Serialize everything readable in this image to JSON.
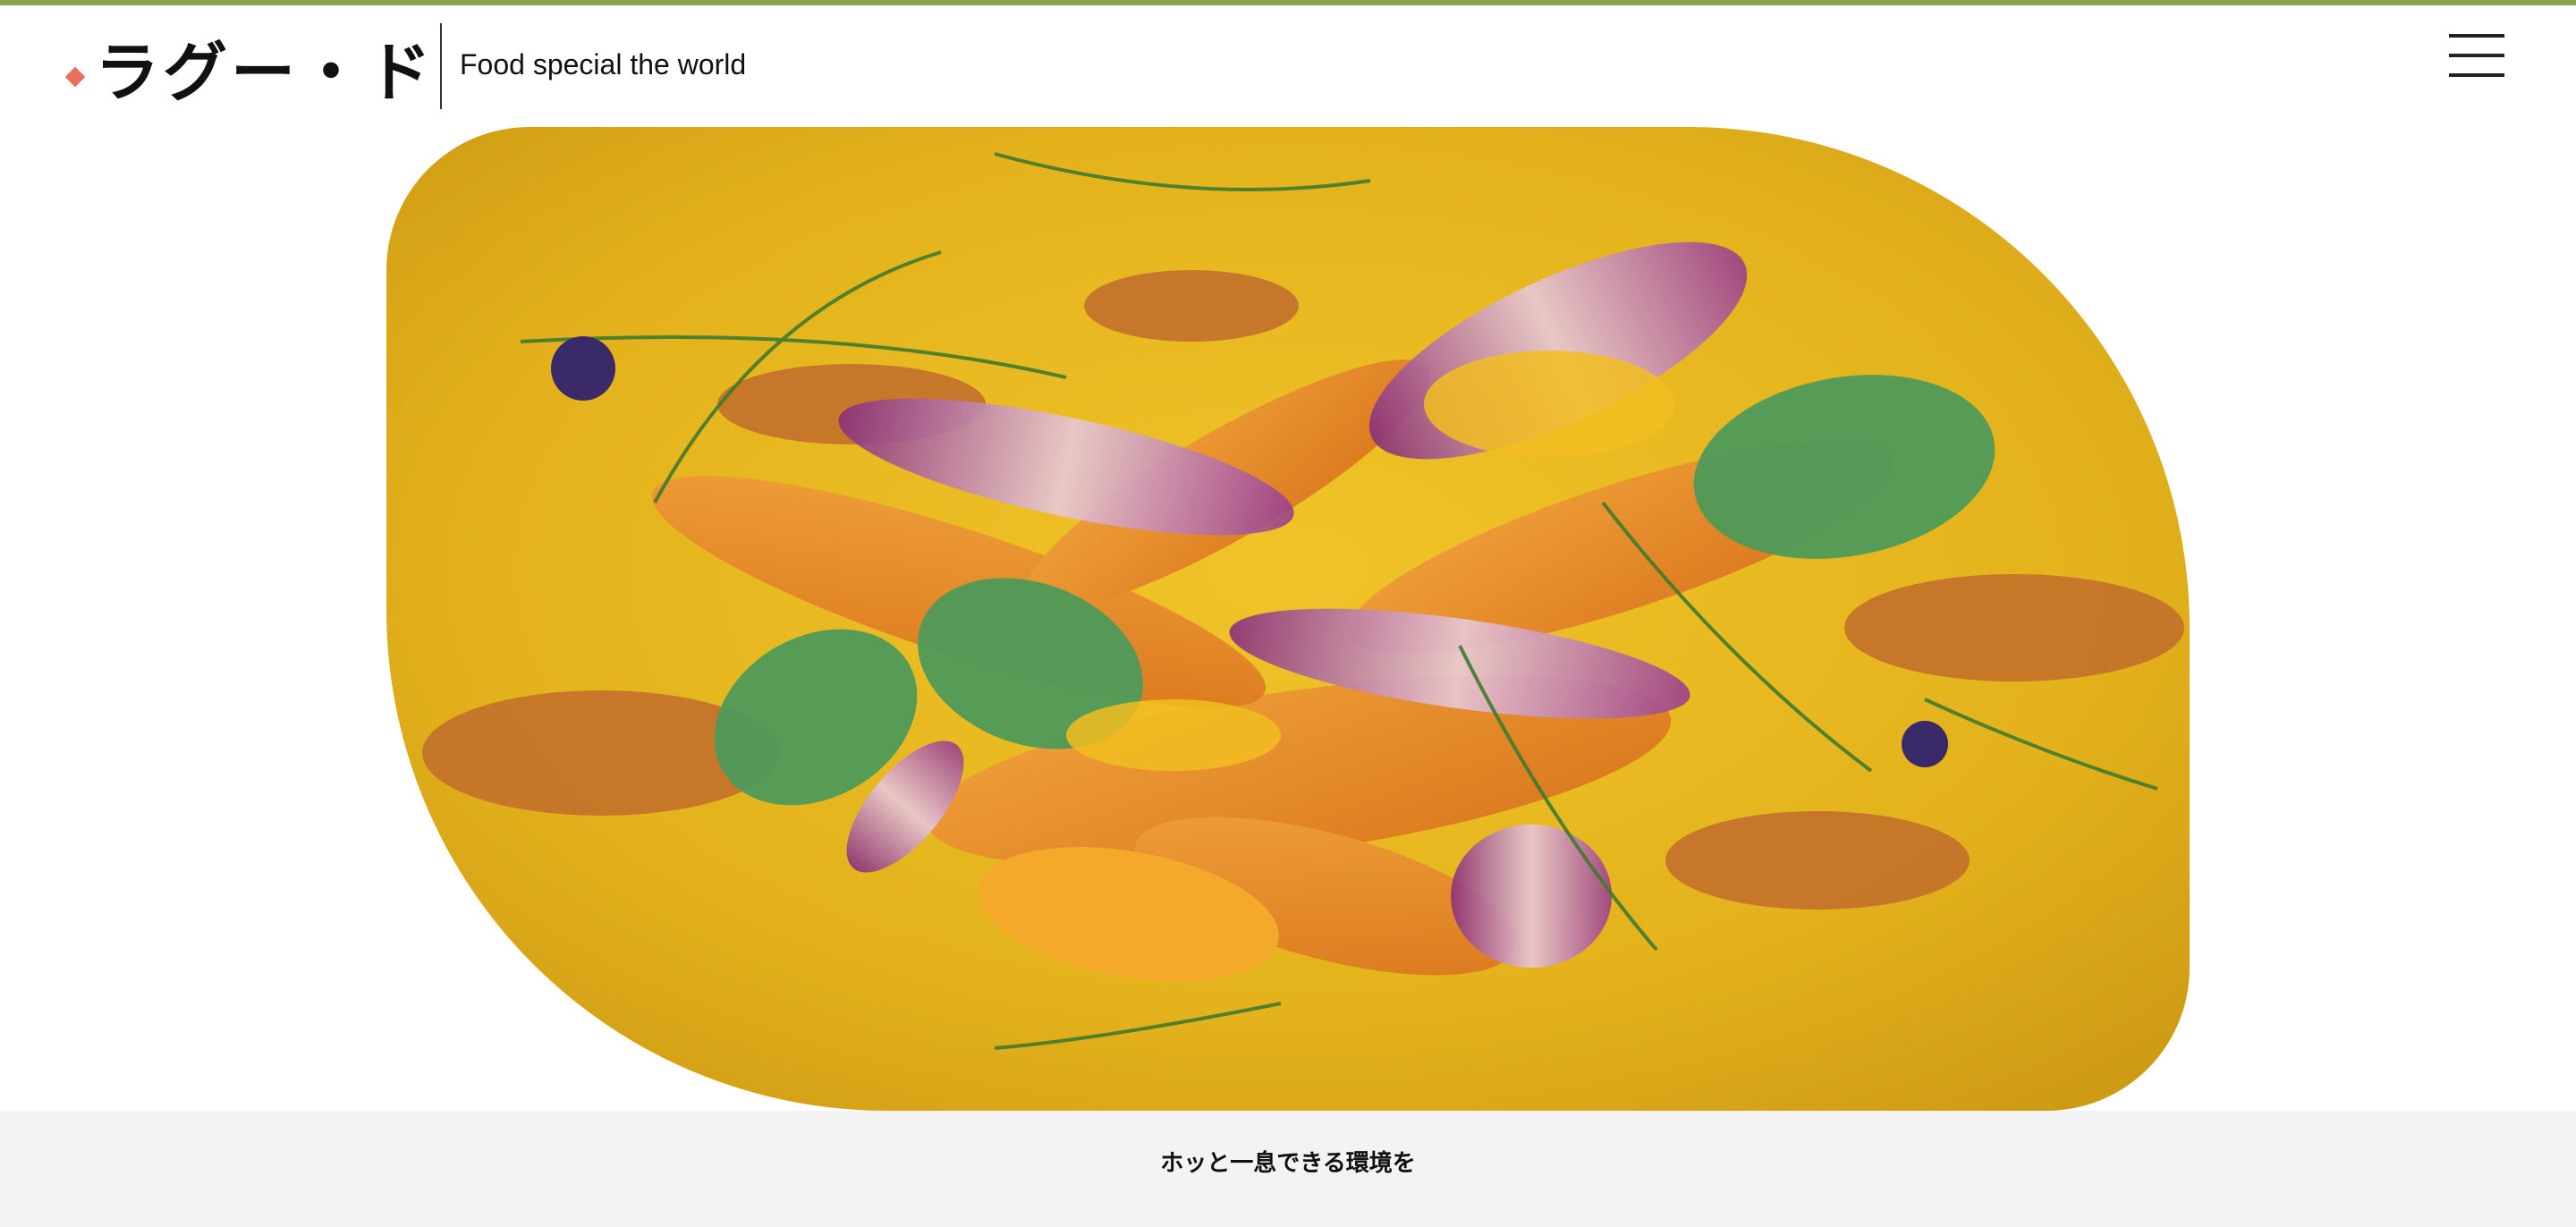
{
  "header": {
    "logo_text": "ラグー・ド",
    "tagline": "Food special the world"
  },
  "hero": {
    "image_alt": "food photograph on yellow plate"
  },
  "band": {
    "text": "ホッと一息できる環境を"
  },
  "colors": {
    "accent_stripe": "#8ba34d",
    "logo_diamond": "#e8705a",
    "band_background": "#f3f3f3"
  }
}
